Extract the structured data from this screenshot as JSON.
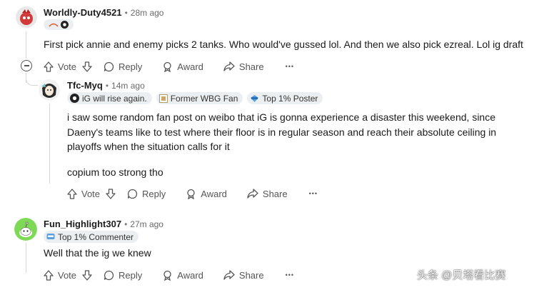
{
  "comments": [
    {
      "username": "Worldly-Duty4521",
      "separator": "•",
      "time": "28m ago",
      "body": "First pick annie and enemy picks 2 tanks. Who would've gussed lol. And then we also pick ezreal. Lol ig draft",
      "actions": {
        "vote": "Vote",
        "reply": "Reply",
        "award": "Award",
        "share": "Share",
        "more": "•••"
      }
    },
    {
      "username": "Tfc-Myq",
      "separator": "•",
      "time": "14m ago",
      "flairs": [
        "iG will rise again.",
        "Former WBG Fan",
        "Top 1% Poster"
      ],
      "body1": "i saw some random fan post on weibo that iG is gonna experience a disaster this weekend, since Daeny's teams like to test where their floor is in regular season and reach their absolute ceiling in playoffs when the situation calls for it",
      "body2": "copium too strong tho",
      "actions": {
        "vote": "Vote",
        "reply": "Reply",
        "award": "Award",
        "share": "Share",
        "more": "•••"
      }
    },
    {
      "username": "Fun_Highlight307",
      "separator": "•",
      "time": "27m ago",
      "flair": "Top 1% Commenter",
      "body": "Well that the ig we knew",
      "actions": {
        "vote": "Vote",
        "reply": "Reply",
        "award": "Award",
        "share": "Share",
        "more": "•••"
      }
    }
  ],
  "watermark": "头条 @贝塔看比赛",
  "colors": {
    "text": "#1a1a1b",
    "muted": "#6a6a6a",
    "flair_bg": "#eceff1",
    "thread_line": "#d6d6d6"
  }
}
